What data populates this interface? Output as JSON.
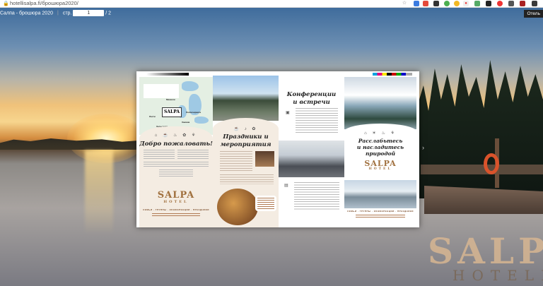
{
  "browser": {
    "url": "hotellisalpa.fi/брошюра2020/"
  },
  "viewer": {
    "title": "Салпа - брошюра 2020",
    "page_label": "стр.",
    "page_current": "1",
    "page_total": "/ 2",
    "right_button": "Отель"
  },
  "brochure": {
    "welcome_title": "Добро пожаловать!",
    "celebrations_title_1": "Праздники и",
    "celebrations_title_2": "мероприятия",
    "conferences_title_1": "Конференции",
    "conferences_title_2": "и встречи",
    "relax_title_1": "Расслабьтесь",
    "relax_title_2": "и насладитесь",
    "relax_title_3": "природой",
    "logo_salpa": "SALPA",
    "logo_hotel": "HOTEL",
    "tagline_left": "СЕМЬИ · ГРУППЫ · КОНФЕРЕНЦИИ · ПРАЗДНИКИ",
    "tagline_right": "СЕМЬИ · ГРУППЫ · КОНФЕРЕНЦИИ · ПРАЗДНИКИ",
    "map_labels": [
      "Миккели",
      "Хельсинки",
      "Лахти",
      "Котка",
      "Хамина",
      "Лаппеэнранта"
    ]
  },
  "background_logo": {
    "salpa": "SALPA",
    "hotel": "HOTELL"
  }
}
